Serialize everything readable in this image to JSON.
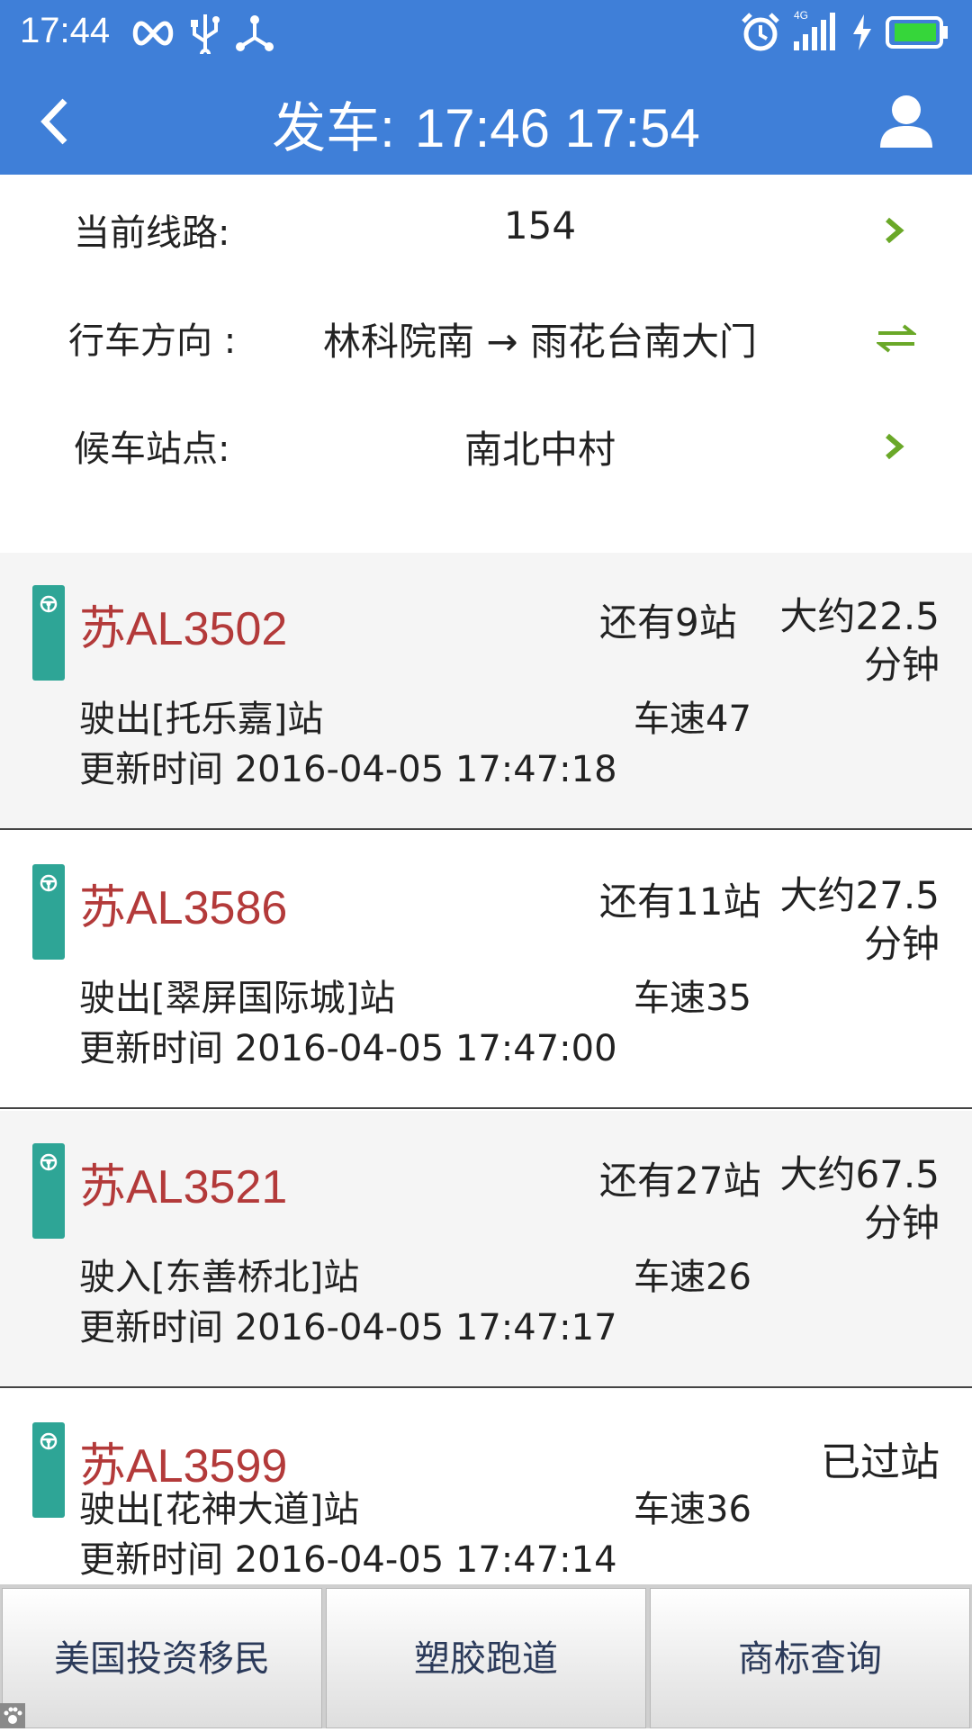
{
  "status_bar": {
    "time": "17:44",
    "icons": [
      "infinity-icon",
      "usb-icon",
      "share-icon",
      "alarm-icon",
      "signal-4g-icon",
      "charging-icon",
      "battery-icon"
    ],
    "network_label": "4G"
  },
  "header": {
    "title_prefix": "发车:",
    "title_times": "17:46 17:54",
    "back_icon": "chevron-left-icon",
    "user_icon": "user-icon",
    "background_color": "#3f7fd8"
  },
  "route_info": {
    "line_label": "当前线路:",
    "line_value": "154",
    "direction_label": "行车方向 :",
    "direction_value": "林科院南 → 雨花台南大门",
    "stop_label": "候车站点:",
    "stop_value": "南北中村",
    "accent_color": "#6aa828"
  },
  "buses": [
    {
      "plate": "苏AL3502",
      "stops_left": "还有9站",
      "eta": "大约22.5分钟",
      "position": "驶出[托乐嘉]站",
      "speed": "车速47",
      "updated": "更新时间 2016-04-05 17:47:18"
    },
    {
      "plate": "苏AL3586",
      "stops_left": "还有11站",
      "eta": "大约27.5分钟",
      "position": "驶出[翠屏国际城]站",
      "speed": "车速35",
      "updated": "更新时间 2016-04-05 17:47:00"
    },
    {
      "plate": "苏AL3521",
      "stops_left": "还有27站",
      "eta": "大约67.5分钟",
      "position": "驶入[东善桥北]站",
      "speed": "车速26",
      "updated": "更新时间 2016-04-05 17:47:17"
    },
    {
      "plate": "苏AL3599",
      "status": "已过站",
      "position": "驶出[花神大道]站",
      "speed": "车速36",
      "updated": "更新时间 2016-04-05 17:47:14"
    }
  ],
  "ads": [
    "美国投资移民",
    "塑胶跑道",
    "商标查询"
  ],
  "colors": {
    "plate": "#b33a3a",
    "badge": "#2ea596"
  }
}
